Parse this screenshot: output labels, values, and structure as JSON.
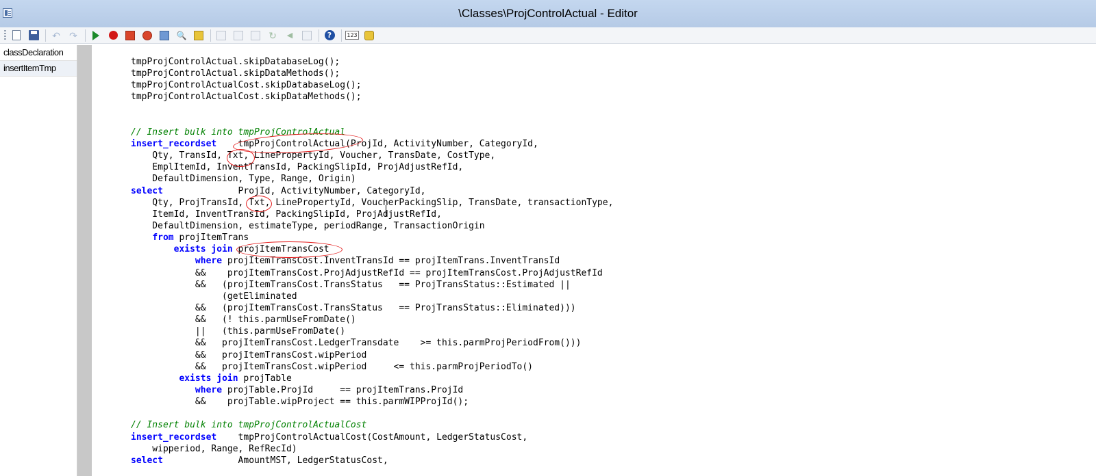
{
  "window": {
    "title": "\\Classes\\ProjControlActual - Editor",
    "icon": "class-editor-icon"
  },
  "toolbar": {
    "buttons": [
      {
        "name": "new",
        "icon": "new-document-icon"
      },
      {
        "name": "save",
        "icon": "save-icon"
      },
      {
        "name": "undo",
        "icon": "undo-icon",
        "glyph": "↶"
      },
      {
        "name": "redo",
        "icon": "redo-icon",
        "glyph": "↷"
      },
      {
        "name": "compile-run",
        "icon": "run-icon"
      },
      {
        "name": "breakpoint",
        "icon": "breakpoint-icon"
      },
      {
        "name": "remove-breakpoints",
        "icon": "remove-breakpoints-icon"
      },
      {
        "name": "enable-breakpoint",
        "icon": "toggle-breakpoint-icon"
      },
      {
        "name": "lookup",
        "icon": "lookup-icon"
      },
      {
        "name": "find",
        "icon": "find-icon",
        "glyph": "🔍"
      },
      {
        "name": "script",
        "icon": "script-icon"
      },
      {
        "name": "copy",
        "icon": "copy-icon"
      },
      {
        "name": "paste",
        "icon": "paste-icon"
      },
      {
        "name": "properties",
        "icon": "properties-icon"
      },
      {
        "name": "refresh",
        "icon": "refresh-icon",
        "glyph": "↻"
      },
      {
        "name": "go-back",
        "icon": "go-back-icon",
        "glyph": "◀"
      },
      {
        "name": "go-forward",
        "icon": "go-forward-icon"
      },
      {
        "name": "help",
        "icon": "help-icon",
        "glyph": "?"
      },
      {
        "name": "line-numbers",
        "icon": "line-numbers-icon",
        "glyph": "123"
      },
      {
        "name": "best-practices",
        "icon": "best-practice-icon"
      }
    ]
  },
  "methods": [
    {
      "label": "classDeclaration",
      "selected": false
    },
    {
      "label": "insertItemTmp",
      "selected": true
    }
  ],
  "code_lines": [
    [
      [
        "",
        "tmpProjControlActual.skipDatabaseLog();"
      ]
    ],
    [
      [
        "",
        "tmpProjControlActual.skipDataMethods();"
      ]
    ],
    [
      [
        "",
        "tmpProjControlActualCost.skipDatabaseLog();"
      ]
    ],
    [
      [
        "",
        "tmpProjControlActualCost.skipDataMethods();"
      ]
    ],
    [],
    [],
    [
      [
        "cm",
        "// Insert bulk into tmpProjControlActual"
      ]
    ],
    [
      [
        "kw",
        "insert_recordset"
      ],
      [
        "",
        "    tmpProjControlActual(ProjId, ActivityNumber, CategoryId,"
      ]
    ],
    [
      [
        "",
        "    Qty, TransId, Txt, LinePropertyId, Voucher, TransDate, CostType,"
      ]
    ],
    [
      [
        "",
        "    EmplItemId, InventTransId, PackingSlipId, ProjAdjustRefId,"
      ]
    ],
    [
      [
        "",
        "    DefaultDimension, Type, Range, Origin)"
      ]
    ],
    [
      [
        "kw",
        "select"
      ],
      [
        "",
        "              ProjId, ActivityNumber, CategoryId,"
      ]
    ],
    [
      [
        "",
        "    Qty, ProjTransId, Txt, LinePropertyId, VoucherPackingSlip, TransDate, transactionType,"
      ]
    ],
    [
      [
        "",
        "    ItemId, InventTransId, PackingSlipId, ProjAdjustRefId,"
      ]
    ],
    [
      [
        "",
        "    DefaultDimension, estimateType, periodRange, TransactionOrigin"
      ]
    ],
    [
      [
        "",
        "    "
      ],
      [
        "kw",
        "from"
      ],
      [
        "",
        " projItemTrans"
      ]
    ],
    [
      [
        "",
        "        "
      ],
      [
        "kw",
        "exists join"
      ],
      [
        "",
        " projItemTransCost"
      ]
    ],
    [
      [
        "",
        "            "
      ],
      [
        "kw",
        "where"
      ],
      [
        "",
        " projItemTransCost.InventTransId == projItemTrans.InventTransId"
      ]
    ],
    [
      [
        "",
        "            &&    projItemTransCost.ProjAdjustRefId == projItemTransCost.ProjAdjustRefId"
      ]
    ],
    [
      [
        "",
        "            &&   (projItemTransCost.TransStatus   == ProjTransStatus::Estimated ||"
      ]
    ],
    [
      [
        "",
        "                 (getEliminated"
      ]
    ],
    [
      [
        "",
        "            &&   (projItemTransCost.TransStatus   == ProjTransStatus::Eliminated)))"
      ]
    ],
    [
      [
        "",
        "            &&   (! this.parmUseFromDate()"
      ]
    ],
    [
      [
        "",
        "            ||   (this.parmUseFromDate()"
      ]
    ],
    [
      [
        "",
        "            &&   projItemTransCost.LedgerTransdate    >= this.parmProjPeriodFrom()))"
      ]
    ],
    [
      [
        "",
        "            &&   projItemTransCost.wipPeriod"
      ]
    ],
    [
      [
        "",
        "            &&   projItemTransCost.wipPeriod     <= this.parmProjPeriodTo()"
      ]
    ],
    [
      [
        "",
        "         "
      ],
      [
        "kw",
        "exists join"
      ],
      [
        "",
        " projTable"
      ]
    ],
    [
      [
        "",
        "            "
      ],
      [
        "kw",
        "where"
      ],
      [
        "",
        " projTable.ProjId     == projItemTrans.ProjId"
      ]
    ],
    [
      [
        "",
        "            &&    projTable.wipProject == this.parmWIPProjId();"
      ]
    ],
    [],
    [
      [
        "cm",
        "// Insert bulk into tmpProjControlActualCost"
      ]
    ],
    [
      [
        "kw",
        "insert_recordset"
      ],
      [
        "",
        "    tmpProjControlActualCost(CostAmount, LedgerStatusCost,"
      ]
    ],
    [
      [
        "",
        "    wipperiod, Range, RefRecId)"
      ]
    ],
    [
      [
        "kw",
        "select"
      ],
      [
        "",
        "              AmountMST, LedgerStatusCost,"
      ]
    ]
  ]
}
